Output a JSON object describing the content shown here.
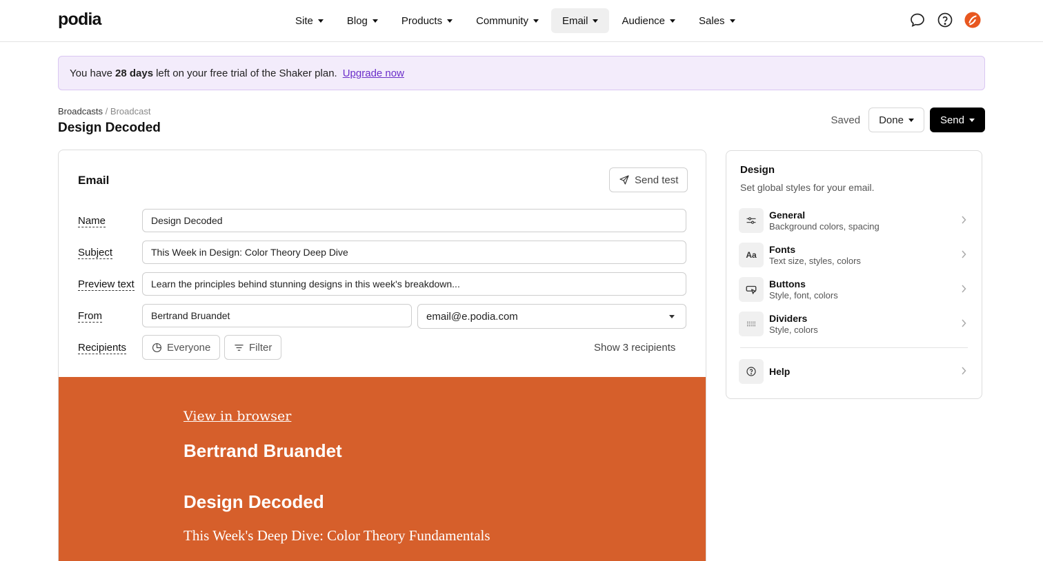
{
  "app": {
    "logo": "podia"
  },
  "nav": {
    "items": [
      {
        "label": "Site"
      },
      {
        "label": "Blog"
      },
      {
        "label": "Products"
      },
      {
        "label": "Community"
      },
      {
        "label": "Email",
        "active": true
      },
      {
        "label": "Audience"
      },
      {
        "label": "Sales"
      }
    ],
    "icons": [
      "chat-icon",
      "help-icon",
      "avatar-icon"
    ]
  },
  "trial": {
    "prefix": "You have",
    "days": "28 days",
    "suffix": "left on your free trial of the Shaker plan.",
    "upgrade_label": "Upgrade now"
  },
  "breadcrumb": {
    "parent": "Broadcasts",
    "separator": "/",
    "current": "Broadcast"
  },
  "page": {
    "title": "Design Decoded"
  },
  "actions": {
    "status": "Saved",
    "done_label": "Done",
    "send_label": "Send"
  },
  "email": {
    "heading": "Email",
    "send_test_label": "Send test",
    "name_label": "Name",
    "name_value": "Design Decoded",
    "subject_label": "Subject",
    "subject_value": "This Week in Design: Color Theory Deep Dive",
    "preview_label": "Preview text",
    "preview_value": "Learn the principles behind stunning designs in this week's breakdown...",
    "from_label": "From",
    "from_name": "Bertrand Bruandet",
    "from_email": "email@e.podia.com",
    "recipients_label": "Recipients",
    "everyone_label": "Everyone",
    "filter_label": "Filter",
    "show_recipients": "Show 3 recipients"
  },
  "preview": {
    "view_in_browser": "View in browser",
    "sender": "Bertrand Bruandet",
    "title": "Design Decoded",
    "subtitle": "This Week's Deep Dive: Color Theory Fundamentals",
    "bg_color": "#d65f2b"
  },
  "design": {
    "title": "Design",
    "description": "Set global styles for your email.",
    "items": [
      {
        "label": "General",
        "sub": "Background colors, spacing",
        "icon": "sliders-icon"
      },
      {
        "label": "Fonts",
        "sub": "Text size, styles, colors",
        "icon_text": "Aa"
      },
      {
        "label": "Buttons",
        "sub": "Style, font, colors",
        "icon": "button-cursor-icon"
      },
      {
        "label": "Dividers",
        "sub": "Style, colors",
        "icon": "divider-icon"
      }
    ],
    "help_label": "Help"
  },
  "colors": {
    "accent": "#6b2fc9",
    "trial_bg": "#f3ecfb",
    "brand_avatar": "#e8571f"
  }
}
